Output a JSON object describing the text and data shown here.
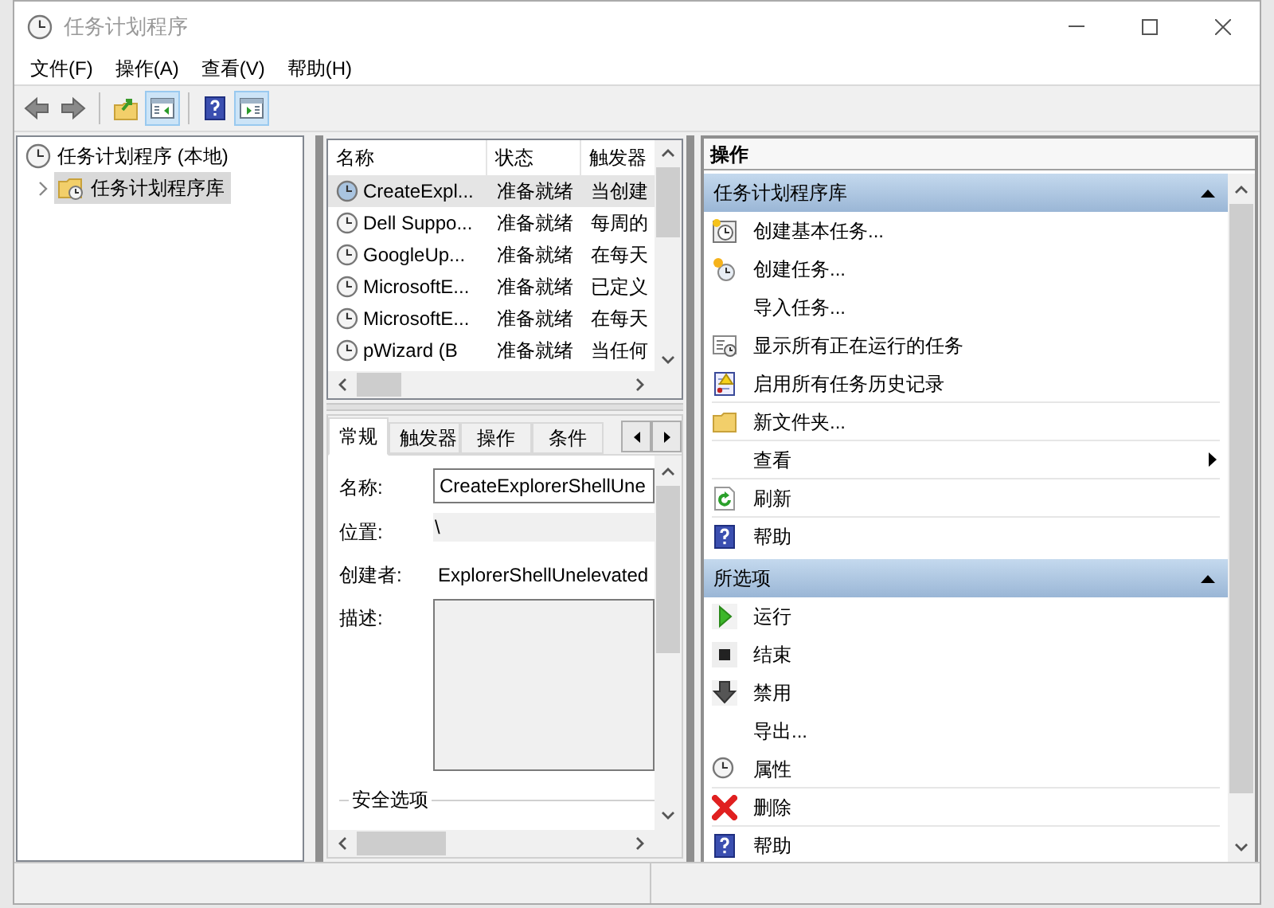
{
  "window": {
    "title": "任务计划程序"
  },
  "menu": [
    "文件(F)",
    "操作(A)",
    "查看(V)",
    "帮助(H)"
  ],
  "toolbar": [
    {
      "kind": "back",
      "selected": false
    },
    {
      "kind": "forward",
      "selected": false
    },
    {
      "kind": "up",
      "selected": false
    },
    {
      "kind": "tree_pane",
      "selected": true
    },
    {
      "kind": "help",
      "selected": false
    },
    {
      "kind": "action_pane",
      "selected": true
    }
  ],
  "tree": [
    {
      "label": "任务计划程序 (本地)",
      "kind": "clock",
      "selected": false,
      "children": [
        {
          "label": "任务计划程序库",
          "kind": "folder_clock",
          "selected": true,
          "expanded": false
        }
      ]
    }
  ],
  "task_list": {
    "columns": [
      "名称",
      "状态",
      "触发器"
    ],
    "rows": [
      {
        "cells": [
          "CreateExpl...",
          "准备就绪",
          "当创建"
        ],
        "selected": true
      },
      {
        "cells": [
          "Dell Suppo...",
          "准备就绪",
          "每周的"
        ],
        "selected": false
      },
      {
        "cells": [
          "GoogleUp...",
          "准备就绪",
          "在每天"
        ],
        "selected": false
      },
      {
        "cells": [
          "MicrosoftE...",
          "准备就绪",
          "已定义"
        ],
        "selected": false
      },
      {
        "cells": [
          "MicrosoftE...",
          "准备就绪",
          "在每天"
        ],
        "selected": false
      },
      {
        "cells": [
          "pWizard (B",
          "准备就绪",
          "当任何"
        ],
        "selected": false
      }
    ]
  },
  "details": {
    "tabs": [
      {
        "label": "常规",
        "selected": true
      },
      {
        "label": "触发器",
        "selected": false
      },
      {
        "label": "操作",
        "selected": false
      },
      {
        "label": "条件",
        "selected": false
      }
    ],
    "fields": [
      {
        "kind": "input",
        "label": "名称:",
        "value": "CreateExplorerShellUne"
      },
      {
        "kind": "readonly",
        "label": "位置:",
        "value": "\\"
      },
      {
        "kind": "text",
        "label": "创建者:",
        "value": "ExplorerShellUnelevated"
      },
      {
        "kind": "textarea",
        "label": "描述:"
      }
    ],
    "section": "安全选项"
  },
  "actions": {
    "title": "操作",
    "groups": [
      {
        "title": "任务计划程序库",
        "expanded": true,
        "items": [
          {
            "label": "创建基本任务...",
            "kind": "create_basic",
            "submenu": false,
            "separator": false
          },
          {
            "label": "创建任务...",
            "kind": "create",
            "submenu": false,
            "separator": false
          },
          {
            "label": "导入任务...",
            "kind": "none",
            "submenu": false,
            "separator": false
          },
          {
            "label": "显示所有正在运行的任务",
            "kind": "running",
            "submenu": false,
            "separator": false
          },
          {
            "label": "启用所有任务历史记录",
            "kind": "history",
            "submenu": false,
            "separator": true
          },
          {
            "label": "新文件夹...",
            "kind": "folder",
            "submenu": false,
            "separator": true
          },
          {
            "label": "查看",
            "kind": "none",
            "submenu": true,
            "separator": true
          },
          {
            "label": "刷新",
            "kind": "refresh",
            "submenu": false,
            "separator": true
          },
          {
            "label": "帮助",
            "kind": "help",
            "submenu": false,
            "separator": false
          }
        ]
      },
      {
        "title": "所选项",
        "expanded": true,
        "items": [
          {
            "label": "运行",
            "kind": "run",
            "submenu": false,
            "separator": false
          },
          {
            "label": "结束",
            "kind": "stop",
            "submenu": false,
            "separator": false
          },
          {
            "label": "禁用",
            "kind": "disable",
            "submenu": false,
            "separator": false
          },
          {
            "label": "导出...",
            "kind": "none",
            "submenu": false,
            "separator": false
          },
          {
            "label": "属性",
            "kind": "properties",
            "submenu": false,
            "separator": true
          },
          {
            "label": "删除",
            "kind": "delete",
            "submenu": false,
            "separator": true
          },
          {
            "label": "帮助",
            "kind": "help",
            "submenu": false,
            "separator": false
          }
        ]
      }
    ]
  }
}
